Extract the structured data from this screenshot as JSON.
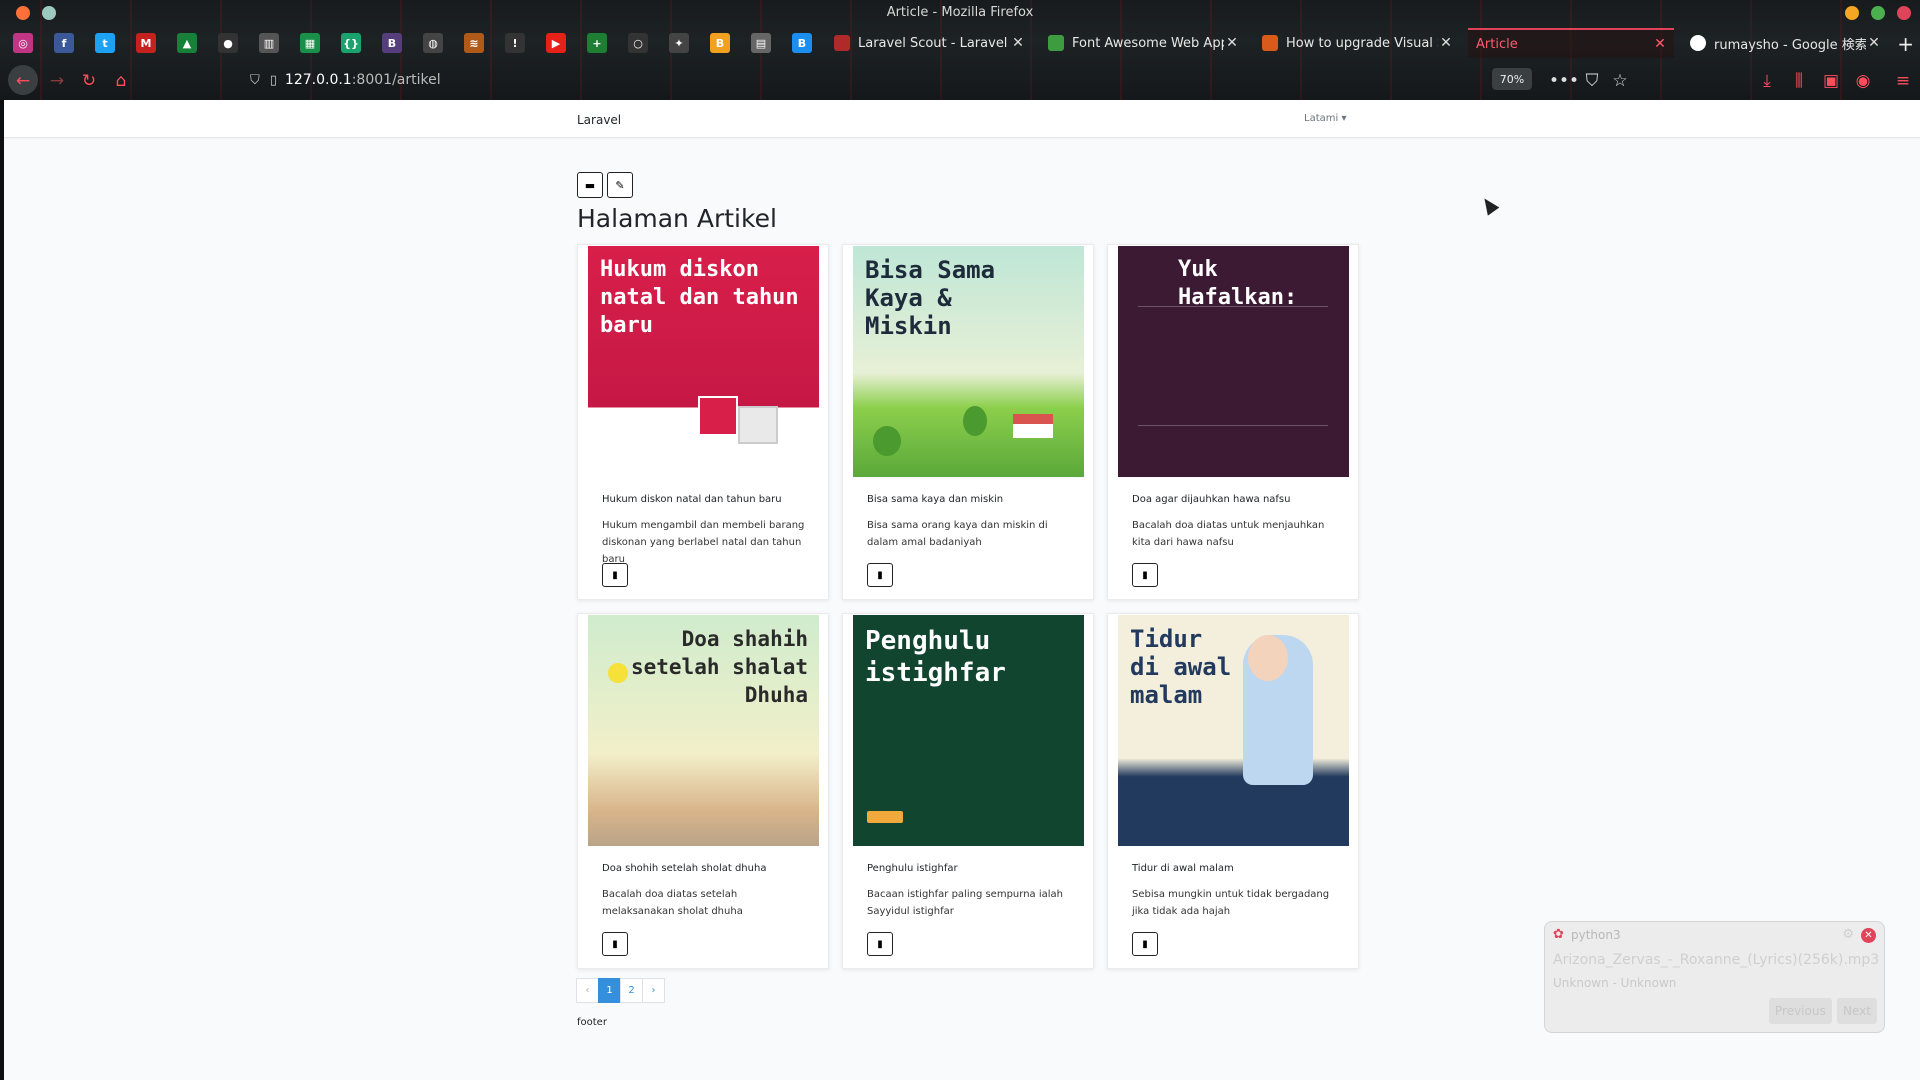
{
  "browser": {
    "window_title": "Article - Mozilla Firefox",
    "url_host": "127.0.0.1",
    "url_rest": ":8001/artikel",
    "zoom": "70%",
    "tabs": [
      {
        "title": "Laravel Scout - Laravel -",
        "color": "#b02a2a"
      },
      {
        "title": "Font Awesome Web App",
        "color": "#3f9b3f"
      },
      {
        "title": "How to upgrade Visual S",
        "color": "#d95b1a"
      },
      {
        "title": "Article",
        "color": "#e0445a"
      },
      {
        "title": "rumaysho - Google 検索",
        "color": "#ffffff"
      }
    ],
    "pinned_icons": [
      {
        "name": "instagram-icon",
        "glyph": "◎",
        "color": "#c13584"
      },
      {
        "name": "facebook-icon",
        "glyph": "f",
        "color": "#3b5998"
      },
      {
        "name": "twitter-icon",
        "glyph": "t",
        "color": "#1da1f2"
      },
      {
        "name": "gmail-icon",
        "glyph": "M",
        "color": "#c5221f"
      },
      {
        "name": "drive-icon",
        "glyph": "▲",
        "color": "#188038"
      },
      {
        "name": "github-icon",
        "glyph": "●",
        "color": "#333333"
      },
      {
        "name": "library-icon",
        "glyph": "▥",
        "color": "#555555"
      },
      {
        "name": "sheets-icon",
        "glyph": "▦",
        "color": "#1a8f4a"
      },
      {
        "name": "code-icon",
        "glyph": "{}",
        "color": "#1aa36f"
      },
      {
        "name": "bootstrap-icon",
        "glyph": "B",
        "color": "#563d7c"
      },
      {
        "name": "globe-icon",
        "glyph": "◍",
        "color": "#444444"
      },
      {
        "name": "stack-icon",
        "glyph": "≋",
        "color": "#b05a1a"
      },
      {
        "name": "warning-icon",
        "glyph": "!",
        "color": "#333333"
      },
      {
        "name": "youtube-icon",
        "glyph": "▶",
        "color": "#e62117"
      },
      {
        "name": "plus-cross-icon",
        "glyph": "+",
        "color": "#1e7e34"
      },
      {
        "name": "circle-icon",
        "glyph": "○",
        "color": "#333333"
      },
      {
        "name": "puzzle-icon",
        "glyph": "✦",
        "color": "#444444"
      },
      {
        "name": "bookmark-icon",
        "glyph": "B",
        "color": "#f2a020"
      },
      {
        "name": "note-icon",
        "glyph": "▤",
        "color": "#666666"
      },
      {
        "name": "b-icon",
        "glyph": "B",
        "color": "#1c8ef0"
      }
    ]
  },
  "app": {
    "brand": "Laravel",
    "user": "Latami ▾"
  },
  "page": {
    "title": "Halaman Artikel",
    "folder_icon": "folder-icon",
    "edit_icon": "pencil-icon"
  },
  "articles": [
    {
      "title": "Hukum diskon natal dan tahun baru",
      "desc": "Hukum mengambil dan membeli barang diskonan yang berlabel natal dan tahun baru",
      "thumb_text": "Hukum diskon natal dan tahun baru",
      "thumb_bg": "#d81f4a",
      "thumb_fg": "#ffffff"
    },
    {
      "title": "Bisa sama kaya dan miskin",
      "desc": "Bisa sama orang kaya dan miskin di dalam amal badaniyah",
      "thumb_text": "Bisa Sama Kaya & Miskin",
      "thumb_bg": "#bfe6d6",
      "thumb_fg": "#1d2b3a"
    },
    {
      "title": "Doa agar dijauhkan hawa nafsu",
      "desc": "Bacalah doa diatas untuk menjauhkan kita dari hawa nafsu",
      "thumb_text": "Yuk Hafalkan:",
      "thumb_bg": "#3c1a33",
      "thumb_fg": "#ffffff"
    },
    {
      "title": "Doa shohih setelah sholat dhuha",
      "desc": "Bacalah doa diatas setelah melaksanakan sholat dhuha",
      "thumb_text": "Doa shahih setelah shalat Dhuha",
      "thumb_bg": "#d8ecc2",
      "thumb_fg": "#2a2a2a"
    },
    {
      "title": "Penghulu istighfar",
      "desc": "Bacaan istighfar paling sempurna ialah Sayyidul istighfar",
      "thumb_text": "Penghulu istighfar",
      "thumb_bg": "#12452f",
      "thumb_fg": "#ffffff"
    },
    {
      "title": "Tidur di awal malam",
      "desc": "Sebisa mungkin untuk tidak bergadang jika tidak ada hajah",
      "thumb_text": "Tidur di awal malam",
      "thumb_bg": "#f3efdc",
      "thumb_fg": "#223a5e"
    }
  ],
  "pagination": {
    "prev": "‹",
    "pages": [
      "1",
      "2"
    ],
    "next": "›"
  },
  "footer": "footer",
  "notification": {
    "app": "python3",
    "song": "Arizona_Zervas_-_Roxanne_(Lyrics)(256k).mp3",
    "artist": "Unknown - Unknown",
    "prev": "Previous",
    "next": "Next"
  }
}
